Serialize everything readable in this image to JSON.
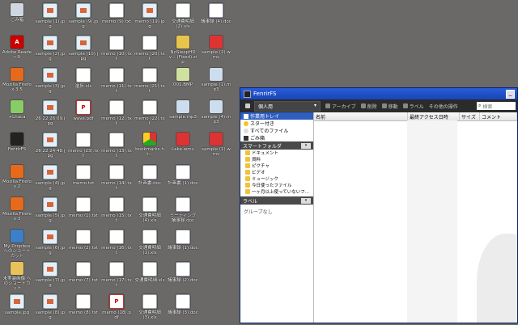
{
  "desktop": {
    "icons": [
      {
        "label": "ごみ箱",
        "kind": "bin",
        "glyph": ""
      },
      {
        "label": "Adobe Reader 9",
        "kind": "adobe",
        "glyph": "A"
      },
      {
        "label": "Mozilla Firefox 3.5",
        "kind": "ff",
        "glyph": ""
      },
      {
        "label": "+Lhaca",
        "kind": "lhaca",
        "glyph": ""
      },
      {
        "label": "FenrirFS",
        "kind": "fenrir",
        "glyph": ""
      },
      {
        "label": "Mozilla Firefox 2",
        "kind": "ff",
        "glyph": ""
      },
      {
        "label": "Mozilla Firefox 3",
        "kind": "ff",
        "glyph": ""
      },
      {
        "label": "My Dropbox へのショートカット",
        "kind": "dbx",
        "glyph": ""
      },
      {
        "label": "未実装画像 へのショートカット",
        "kind": "folder",
        "glyph": ""
      },
      {
        "label": "sample.jpg",
        "kind": "jpg",
        "glyph": ""
      },
      {
        "label": "sample (1).jpg",
        "kind": "jpg",
        "glyph": ""
      },
      {
        "label": "sample (2).jpg",
        "kind": "jpg",
        "glyph": ""
      },
      {
        "label": "sample (3).jpg",
        "kind": "jpg",
        "glyph": ""
      },
      {
        "label": "26 22 26 09.jpg",
        "kind": "jpg",
        "glyph": ""
      },
      {
        "label": "26 22 24 48.jpg",
        "kind": "jpg",
        "glyph": ""
      },
      {
        "label": "sample (4).jpg",
        "kind": "jpg",
        "glyph": ""
      },
      {
        "label": "sample (5).jpg",
        "kind": "jpg",
        "glyph": ""
      },
      {
        "label": "sample (6).jpg",
        "kind": "jpg",
        "glyph": ""
      },
      {
        "label": "sample (7).jpg",
        "kind": "jpg",
        "glyph": ""
      },
      {
        "label": "sample (8).jpg",
        "kind": "jpg",
        "glyph": ""
      },
      {
        "label": "sample (9).jpg",
        "kind": "jpg",
        "glyph": ""
      },
      {
        "label": "sample (10).jpg",
        "kind": "jpg",
        "glyph": ""
      },
      {
        "label": "進捗.xls",
        "kind": "xls",
        "glyph": ""
      },
      {
        "label": "wave.pdf",
        "kind": "pdf",
        "glyph": "P"
      },
      {
        "label": "memo (23).txt",
        "kind": "txt",
        "glyph": ""
      },
      {
        "label": "memo.txt",
        "kind": "txt",
        "glyph": ""
      },
      {
        "label": "memo (1).txt",
        "kind": "txt",
        "glyph": ""
      },
      {
        "label": "memo (2).txt",
        "kind": "txt",
        "glyph": ""
      },
      {
        "label": "memo (7).txt",
        "kind": "txt",
        "glyph": ""
      },
      {
        "label": "memo (8).txt",
        "kind": "txt",
        "glyph": ""
      },
      {
        "label": "memo (9).txt",
        "kind": "txt",
        "glyph": ""
      },
      {
        "label": "memo (10).txt",
        "kind": "txt",
        "glyph": ""
      },
      {
        "label": "memo (11).txt",
        "kind": "txt",
        "glyph": ""
      },
      {
        "label": "memo (12).txt",
        "kind": "txt",
        "glyph": ""
      },
      {
        "label": "memo (13).txt",
        "kind": "txt",
        "glyph": ""
      },
      {
        "label": "memo (14).txt",
        "kind": "txt",
        "glyph": ""
      },
      {
        "label": "memo (15).txt",
        "kind": "txt",
        "glyph": ""
      },
      {
        "label": "memo (16).txt",
        "kind": "txt",
        "glyph": ""
      },
      {
        "label": "memo (17).txt",
        "kind": "txt",
        "glyph": ""
      },
      {
        "label": "memo (18).pdf",
        "kind": "pdf",
        "glyph": "P"
      },
      {
        "label": "memo (19).jpg",
        "kind": "jpg",
        "glyph": ""
      },
      {
        "label": "memo (20).txt",
        "kind": "txt",
        "glyph": ""
      },
      {
        "label": "memo (21).txt",
        "kind": "txt",
        "glyph": ""
      },
      {
        "label": "memo (22).txt",
        "kind": "txt",
        "glyph": ""
      },
      {
        "label": "bookmarks.ht...",
        "kind": "chrome",
        "glyph": ""
      },
      {
        "label": "計画書.doc",
        "kind": "doc",
        "glyph": ""
      },
      {
        "label": "交通費明細 (4).xls",
        "kind": "xls",
        "glyph": ""
      },
      {
        "label": "交通費明細 (1).xls",
        "kind": "xls",
        "glyph": ""
      },
      {
        "label": "交通費明細.xls",
        "kind": "xls",
        "glyph": ""
      },
      {
        "label": "交通費明細 (3).xls",
        "kind": "xls",
        "glyph": ""
      },
      {
        "label": "交通費明細 (2).xls",
        "kind": "xls",
        "glyph": ""
      },
      {
        "label": "NoSleepHDv... (Fixed).zip",
        "kind": "zip",
        "glyph": ""
      },
      {
        "label": "001.BMP",
        "kind": "bmp",
        "glyph": ""
      },
      {
        "label": "sample.mp3",
        "kind": "mp3",
        "glyph": ""
      },
      {
        "label": "Lake.wmv",
        "kind": "wmv",
        "glyph": ""
      },
      {
        "label": "計画書 (1).doc",
        "kind": "doc",
        "glyph": ""
      },
      {
        "label": "ミーティング議事録.doc",
        "kind": "doc",
        "glyph": ""
      },
      {
        "label": "議事録 (1).doc",
        "kind": "doc",
        "glyph": ""
      },
      {
        "label": "議事録 (2).doc",
        "kind": "doc",
        "glyph": ""
      },
      {
        "label": "議事録 (3).doc",
        "kind": "doc",
        "glyph": ""
      },
      {
        "label": "議事録 (4).doc",
        "kind": "doc",
        "glyph": ""
      },
      {
        "label": "sample (2).wmv",
        "kind": "wmv",
        "glyph": ""
      },
      {
        "label": "sample (1).mp3",
        "kind": "mp3",
        "glyph": ""
      },
      {
        "label": "sample (4).mp3",
        "kind": "mp3",
        "glyph": ""
      },
      {
        "label": "sample (1).wmv",
        "kind": "wmv",
        "glyph": ""
      }
    ]
  },
  "window": {
    "title": "FenrirFS",
    "minimize_glyph": "_",
    "toolbar": {
      "profile": "個人用",
      "profile_arrow": "▾",
      "archive": "アーカイブ",
      "delete": "削除",
      "move": "移動",
      "label": "ラベル",
      "other": "その他の操作",
      "search_placeholder": "検索"
    },
    "sidebar": {
      "items": [
        "作業用トレイ",
        "スター付き",
        "すべてのファイル",
        "ごみ箱"
      ],
      "smart_header": "スマートフォルダ",
      "smart_folders": [
        "ドキュメント",
        "資料",
        "ピクチャ",
        "ビデオ",
        "ミュージック",
        "今日使ったファイル",
        "一ヶ月以上使っていないフ..."
      ],
      "label_header": "ラベル",
      "no_group": "グループなし"
    },
    "columns": [
      "名前",
      "最終アクセス日時",
      "サイズ",
      "コメント"
    ]
  }
}
